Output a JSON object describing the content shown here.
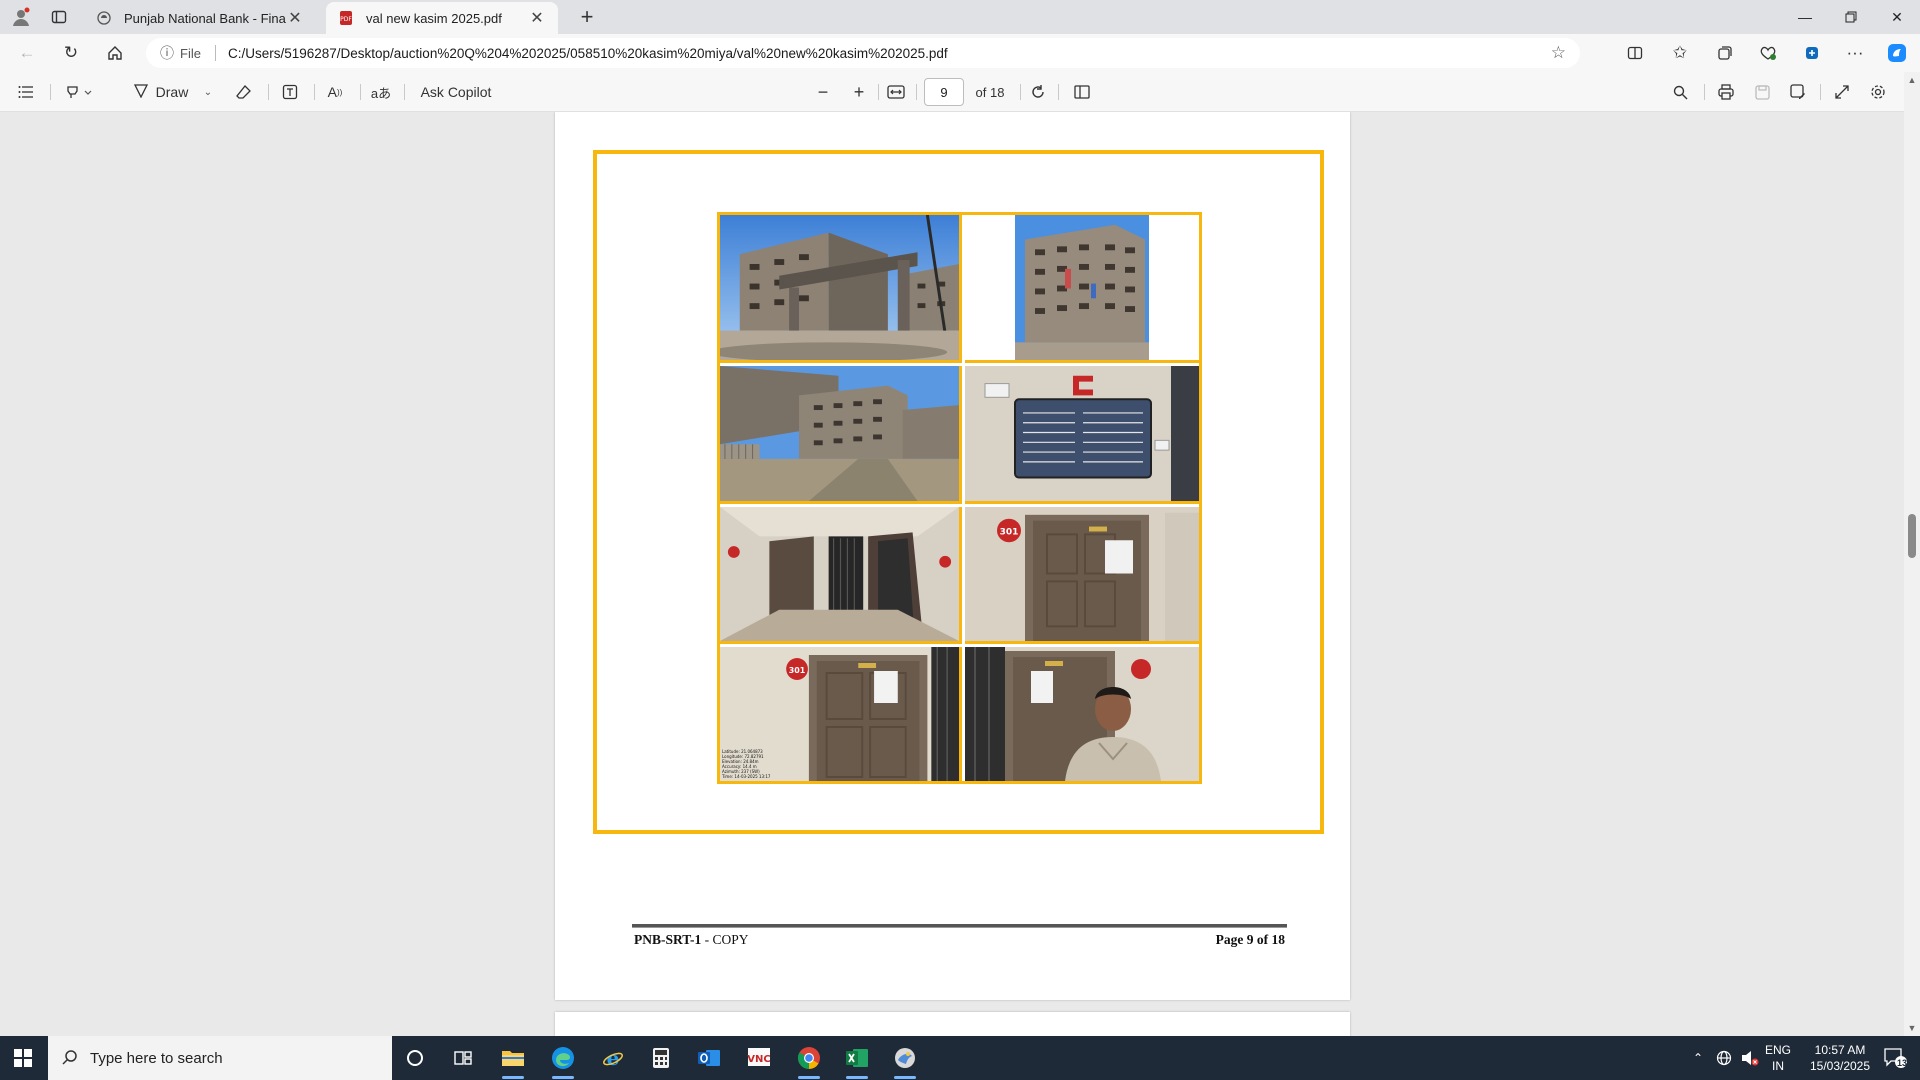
{
  "browser": {
    "tabs": [
      {
        "title": "Punjab National Bank - Finacle",
        "active": false
      },
      {
        "title": "val new kasim 2025.pdf",
        "active": true
      }
    ],
    "address": {
      "file_label": "File",
      "url": "C:/Users/5196287/Desktop/auction%20Q%204%202025/058510%20kasim%20miya/val%20new%20kasim%202025.pdf"
    }
  },
  "pdf_toolbar": {
    "draw_label": "Draw",
    "ask_copilot_label": "Ask Copilot",
    "page_number": "9",
    "page_total": "of 18"
  },
  "document": {
    "footer_left_bold": "PNB-SRT-1",
    "footer_left_rest": " - COPY",
    "footer_right": "Page 9 of 18",
    "door_number": "301",
    "photo_geo_lines": [
      "Latitude: 21.064873",
      "Longitude: 72.82791",
      "Elevation: 24.84m",
      "Accuracy: 14.4 m",
      "Azimuth: 237 (SW)",
      "Time: 14-03-2025 13:17"
    ],
    "photos": [
      "building-gate-photo",
      "building-photo",
      "building-approach-photo",
      "society-notice-board-photo",
      "corridor-doors-photo",
      "flat-door-photo",
      "flat-door-geotag-photo",
      "selfie-at-door-photo"
    ]
  },
  "taskbar": {
    "search_placeholder": "Type here to search",
    "lang_line1": "ENG",
    "lang_line2": "IN",
    "time": "10:57 AM",
    "date": "15/03/2025",
    "notification_count": "13"
  },
  "colors": {
    "frame_accent": "#f7b70f",
    "taskbar_bg": "#1f2a38"
  }
}
